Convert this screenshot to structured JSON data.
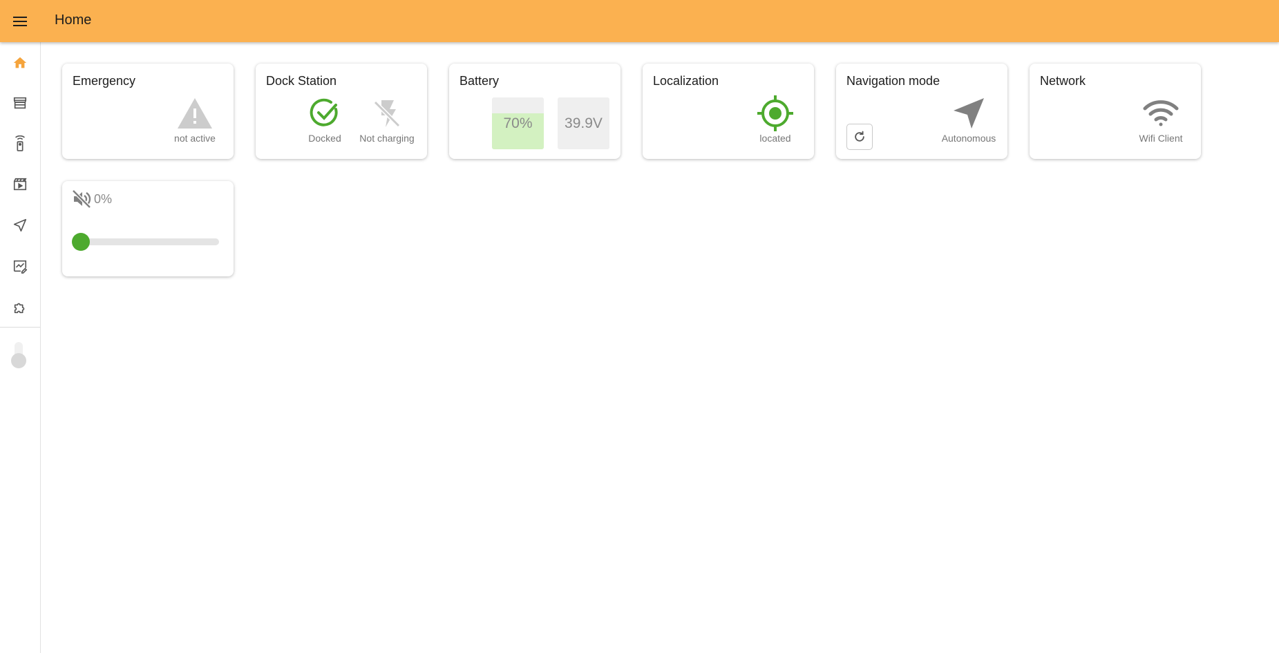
{
  "header": {
    "title": "Home",
    "menu_icon": "menu-icon",
    "background_color": "#fbb150"
  },
  "sidebar": {
    "items": [
      {
        "id": "home",
        "icon": "home-icon",
        "active": true
      },
      {
        "id": "store",
        "icon": "store-icon",
        "active": false
      },
      {
        "id": "remote",
        "icon": "remote-icon",
        "active": false
      },
      {
        "id": "video",
        "icon": "clapperboard-icon",
        "active": false
      },
      {
        "id": "navigation",
        "icon": "navigation-arrow-icon",
        "active": false
      },
      {
        "id": "logs",
        "icon": "chart-edit-icon",
        "active": false
      },
      {
        "id": "plugins",
        "icon": "puzzle-icon",
        "active": false
      }
    ],
    "active_color": "#f5a43c",
    "theme_toggle": {
      "enabled": false
    }
  },
  "cards": {
    "emergency": {
      "title": "Emergency",
      "status": "not active",
      "icon": "warning-icon"
    },
    "dock": {
      "title": "Dock Station",
      "docked_label": "Docked",
      "docked_icon": "check-circle-icon",
      "charging_label": "Not charging",
      "charging_icon": "flash-off-icon"
    },
    "battery": {
      "title": "Battery",
      "percent": 70,
      "percent_label": "70%",
      "voltage": "39.9V"
    },
    "localization": {
      "title": "Localization",
      "status": "located",
      "icon": "gps-fixed-icon"
    },
    "navigation": {
      "title": "Navigation mode",
      "mode": "Autonomous",
      "icon": "navigation-arrow-icon",
      "reload_icon": "reload-icon"
    },
    "network": {
      "title": "Network",
      "status": "Wifi Client",
      "icon": "wifi-icon"
    },
    "volume": {
      "muted": true,
      "percent": 0,
      "label": "0%",
      "icon": "volume-off-icon"
    }
  },
  "colors": {
    "ok_green": "#4daa2e",
    "inactive_gray": "#c8c8c8",
    "icon_gray": "#808080"
  }
}
